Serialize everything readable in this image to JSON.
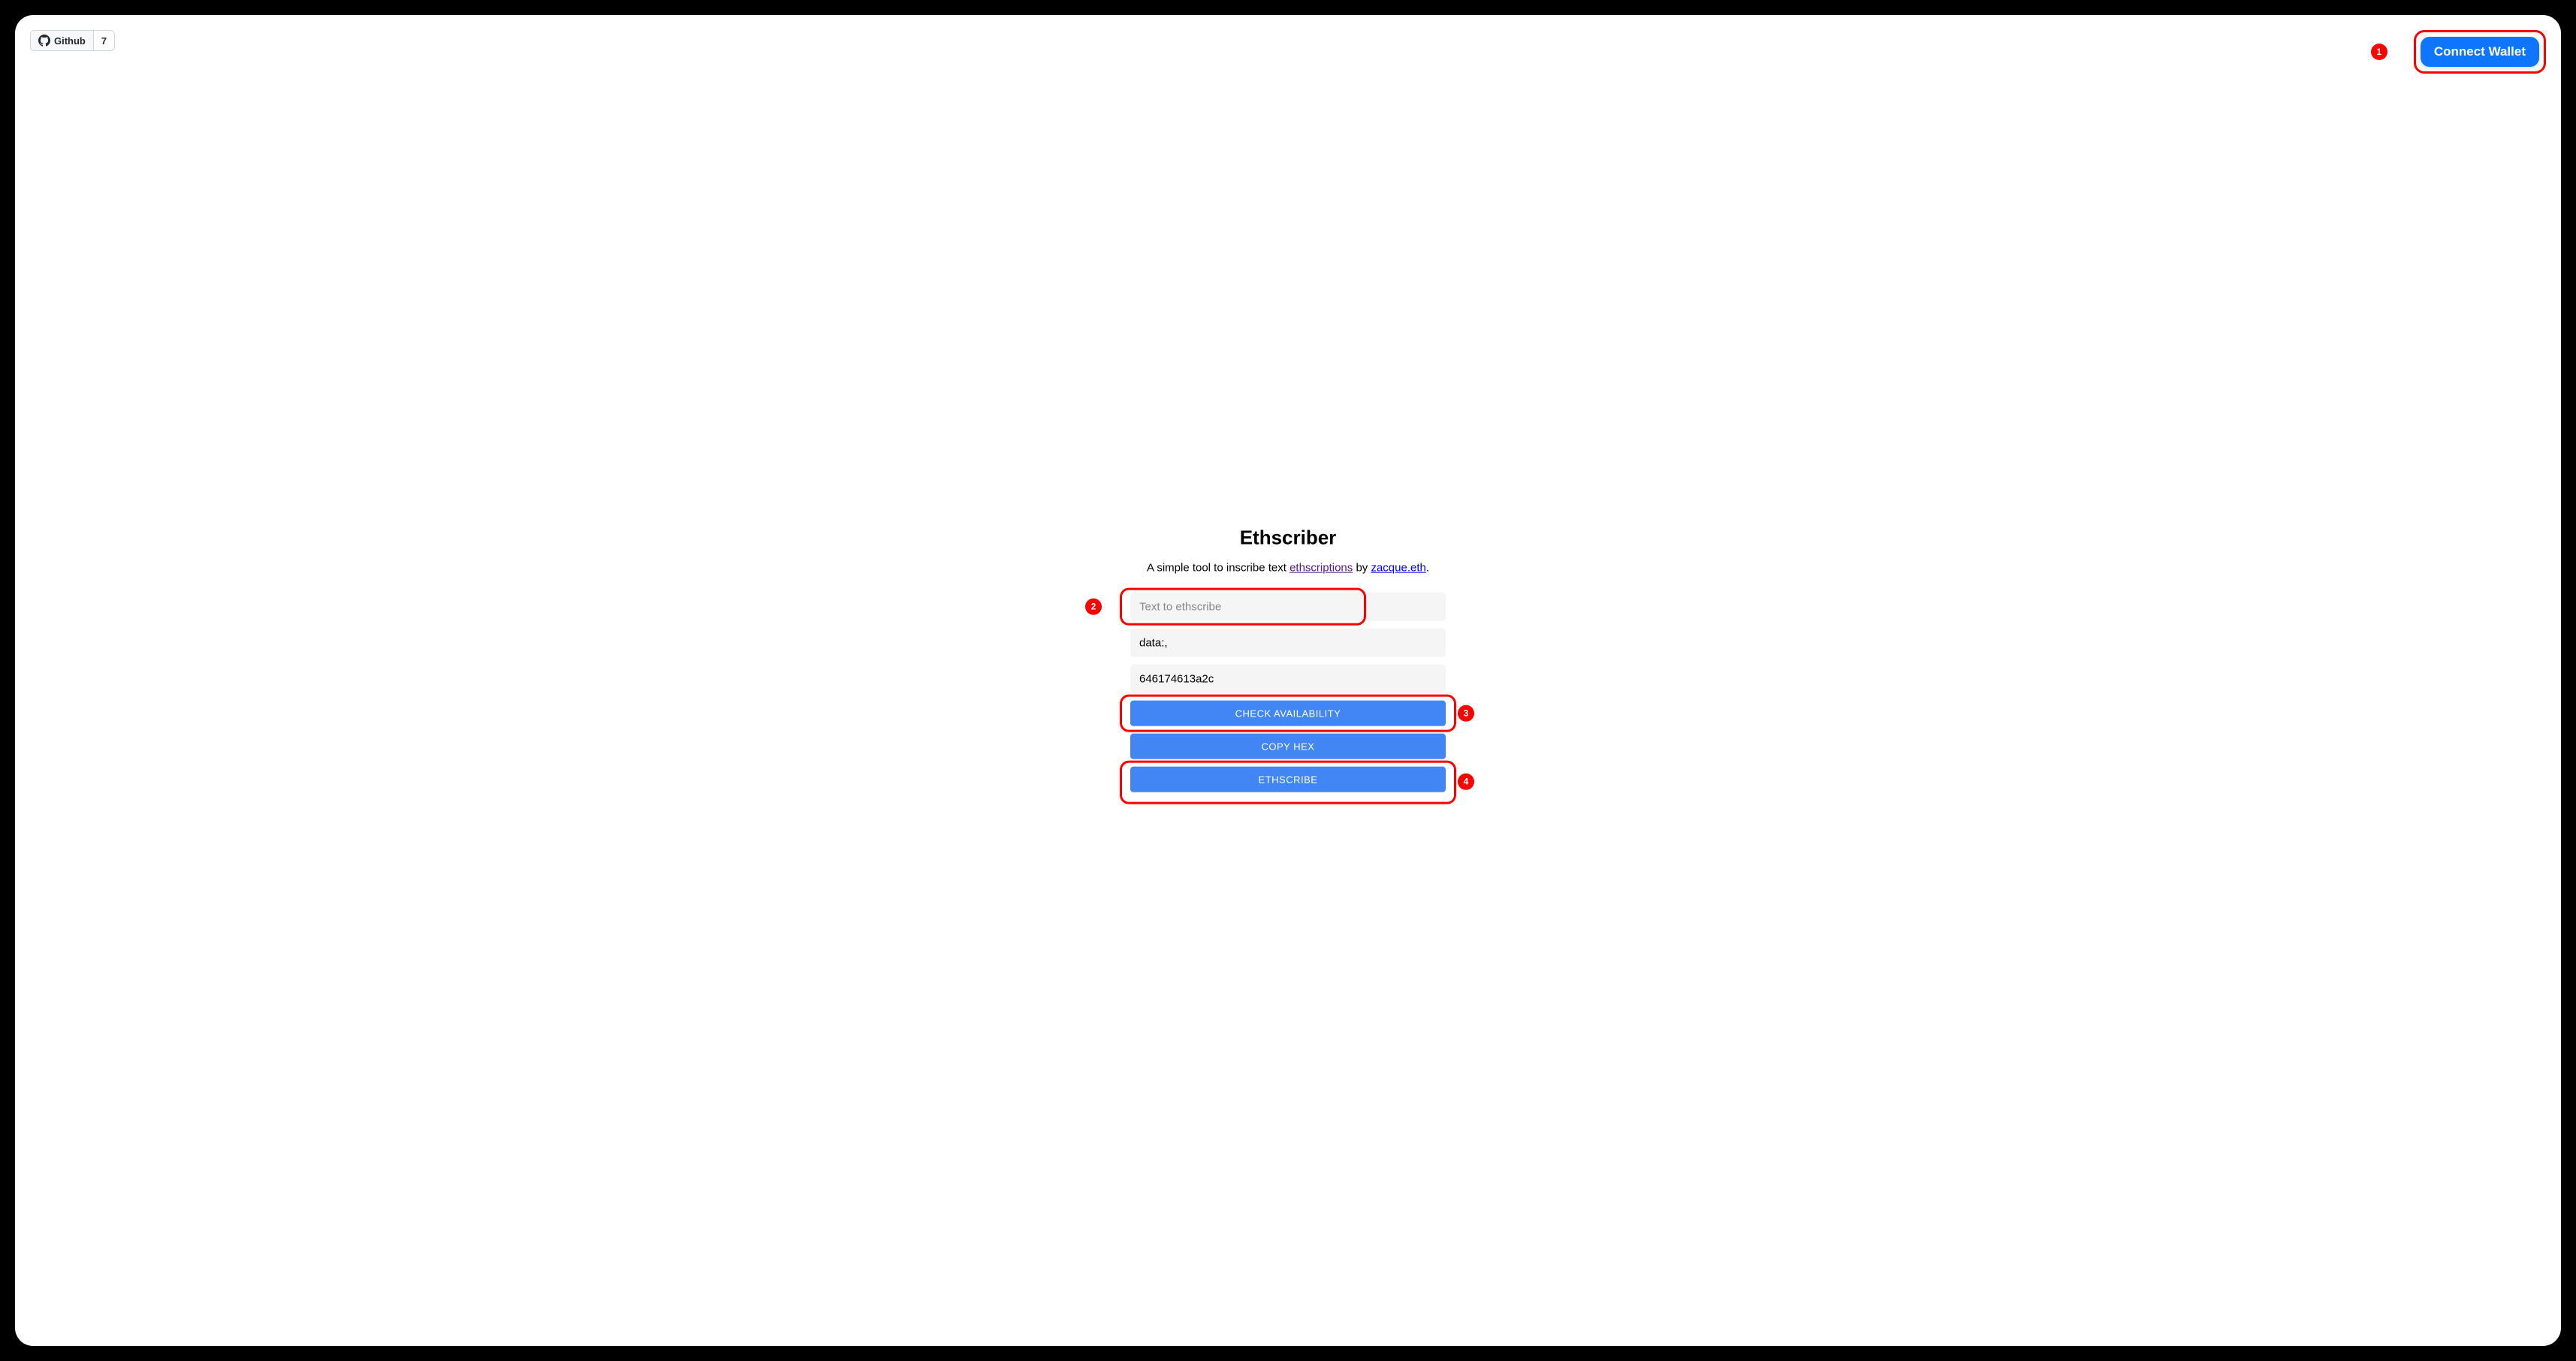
{
  "header": {
    "github_label": "Github",
    "github_count": "7",
    "connect_wallet_label": "Connect Wallet"
  },
  "main": {
    "title": "Ethscriber",
    "subtitle_prefix": "A simple tool to inscribe text ",
    "link_ethscriptions": "ethscriptions",
    "subtitle_by": " by ",
    "link_author": "zacque.eth",
    "subtitle_suffix": ".",
    "input_placeholder": "Text to ethscribe",
    "data_prefix_value": "data:,",
    "hex_value": "646174613a2c",
    "check_button": "CHECK AVAILABILITY",
    "copy_button": "COPY HEX",
    "ethscribe_button": "ETHSCRIBE"
  },
  "annotations": {
    "marker_1": "1",
    "marker_2": "2",
    "marker_3": "3",
    "marker_4": "4"
  }
}
